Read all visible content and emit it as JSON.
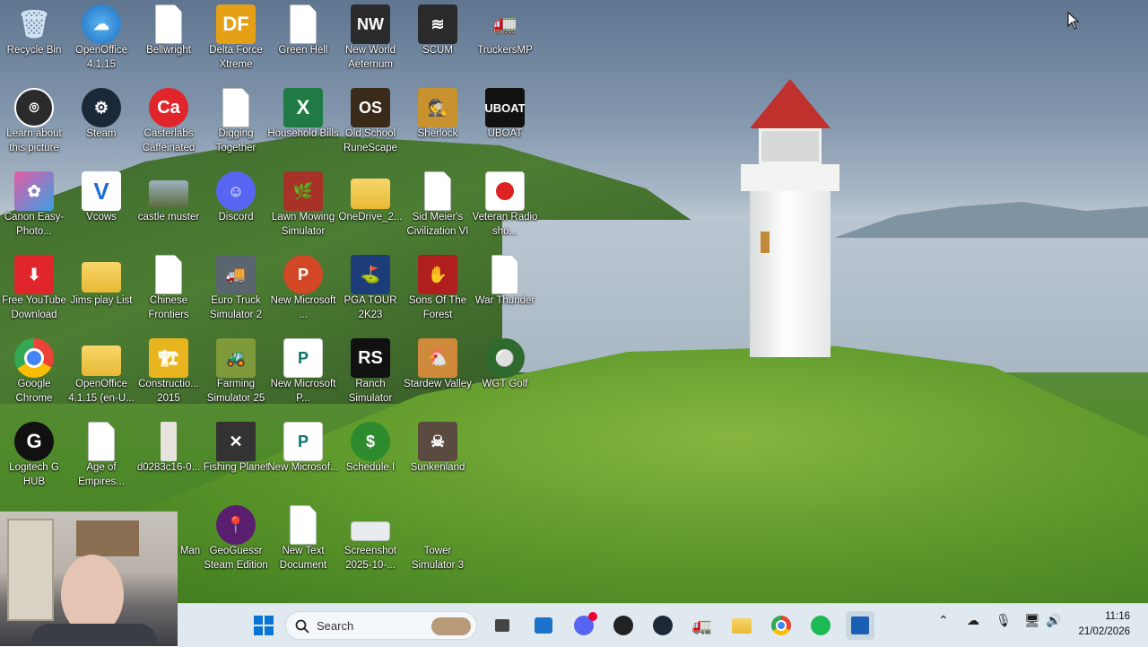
{
  "desktop": {
    "icons": {
      "recycle_bin": "Recycle Bin",
      "openoffice_4115": "OpenOffice 4.1.15",
      "bellwright": "Bellwright",
      "delta_force": "Delta Force Xtreme",
      "green_hell": "Green Hell",
      "new_world": "New World Aeternum",
      "scum": "SCUM",
      "truckersmp": "TruckersMP",
      "learn_about": "Learn about this picture",
      "steam": "Steam",
      "casterlabs": "Casterlabs Caffeinated",
      "digging_together": "Digging Together",
      "household_bills": "Household Bills",
      "old_school_runescape": "Old School RuneScape",
      "sherlock": "Sherlock",
      "uboat": "UBOAT",
      "canon": "Canon Easy-Photo...",
      "vcows": "Vcows",
      "castle_muster": "castle muster",
      "discord": "Discord",
      "lawn_mowing": "Lawn Mowing Simulator",
      "onedrive": "OneDrive_2...",
      "civilization": "Sid Meier's Civilization VI",
      "veteran_radio": "Veteran Radio sho...",
      "free_youtube": "Free YouTube Download",
      "jims_play_list": "Jims play List",
      "chinese_frontiers": "Chinese Frontiers",
      "euro_truck": "Euro Truck Simulator 2",
      "new_microsoft_1": "New Microsoft ...",
      "pga_tour": "PGA TOUR 2K23",
      "sons_forest": "Sons Of The Forest",
      "war_thunder": "War Thunder",
      "google_chrome": "Google Chrome",
      "openoffice_en": "OpenOffice 4.1.15 (en-U...",
      "construction": "Constructio... 2015",
      "farming": "Farming Simulator 25",
      "new_microsoft_2": "New Microsoft P...",
      "ranch": "Ranch Simulator",
      "stardew": "Stardew Valley",
      "wgt_golf": "WGT Golf",
      "logitech": "Logitech G HUB",
      "age_empires": "Age of Empires...",
      "d0283c": "d0283c16-0...",
      "fishing_planet": "Fishing Planet",
      "new_microsoft_3": "New Microsof...",
      "schedule": "Schedule I",
      "sunkenland": "Sunkenland",
      "man": "Man",
      "geoguessr": "GeoGuessr Steam Edition",
      "new_text": "New Text Document",
      "screenshot": "Screenshot 2025-10-...",
      "tower": "Tower Simulator 3"
    }
  },
  "taskbar": {
    "search_placeholder": "Search",
    "time": "11:16",
    "date": "21/02/2026"
  }
}
